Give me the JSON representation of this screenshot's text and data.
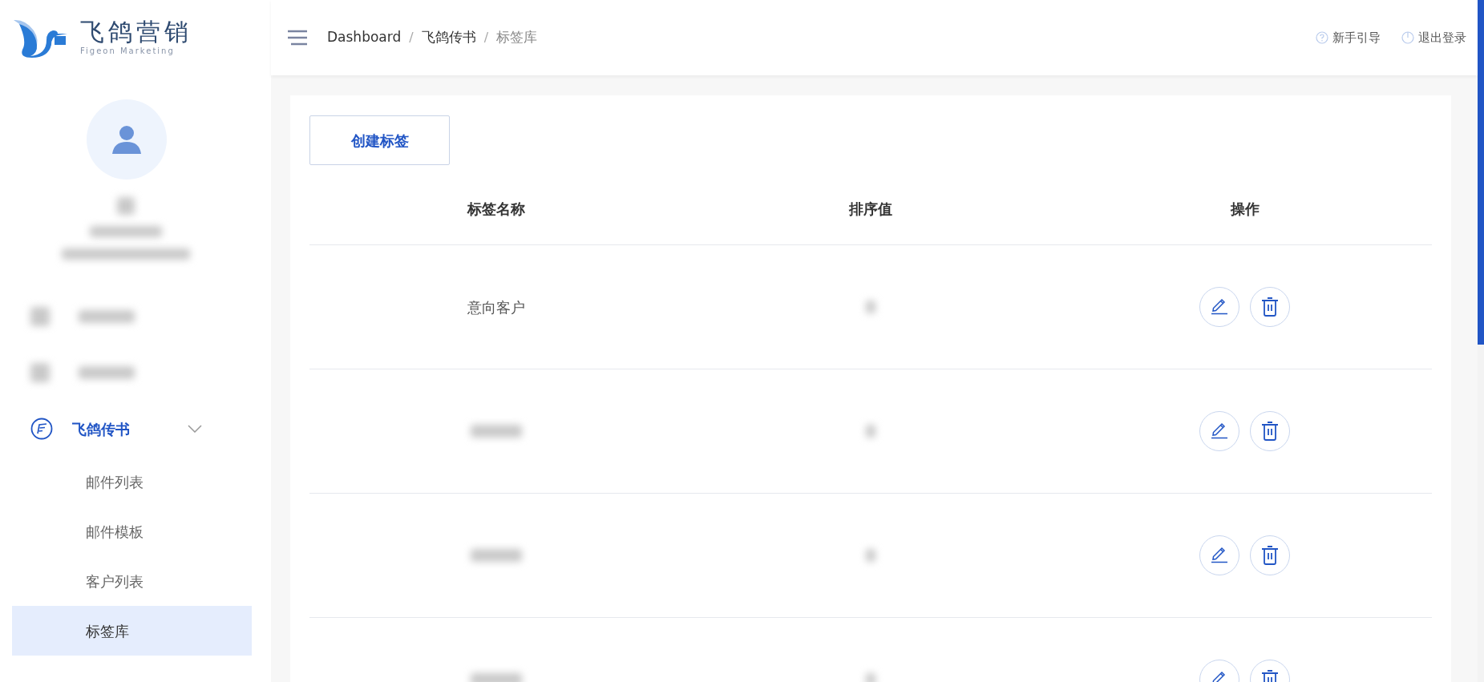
{
  "logo": {
    "title": "飞鸽营销",
    "subtitle": "Figeon Marketing"
  },
  "header": {
    "breadcrumb": [
      {
        "label": "Dashboard",
        "current": false
      },
      {
        "separator": "/",
        "label": "飞鸽传书",
        "current": false
      },
      {
        "separator": "/",
        "label": "标签库",
        "current": true
      }
    ],
    "links": [
      {
        "kind": "help",
        "label": "新手引导"
      },
      {
        "kind": "logout",
        "label": "退出登录"
      }
    ]
  },
  "sidebar": {
    "items": [
      {
        "kind": "redacted"
      },
      {
        "kind": "redacted"
      },
      {
        "kind": "group",
        "label": "飞鸽传书",
        "expanded": true,
        "children": [
          {
            "label": "邮件列表",
            "selected": false
          },
          {
            "label": "邮件模板",
            "selected": false
          },
          {
            "label": "客户列表",
            "selected": false
          },
          {
            "label": "标签库",
            "selected": true
          }
        ]
      }
    ]
  },
  "toolbar": {
    "create_button": "创建标签"
  },
  "table": {
    "columns": [
      "标签名称",
      "排序值",
      "操作"
    ],
    "rows": [
      {
        "kind": "named",
        "name": "意向客户"
      },
      {
        "kind": "redacted"
      },
      {
        "kind": "redacted"
      },
      {
        "kind": "redacted"
      }
    ]
  }
}
